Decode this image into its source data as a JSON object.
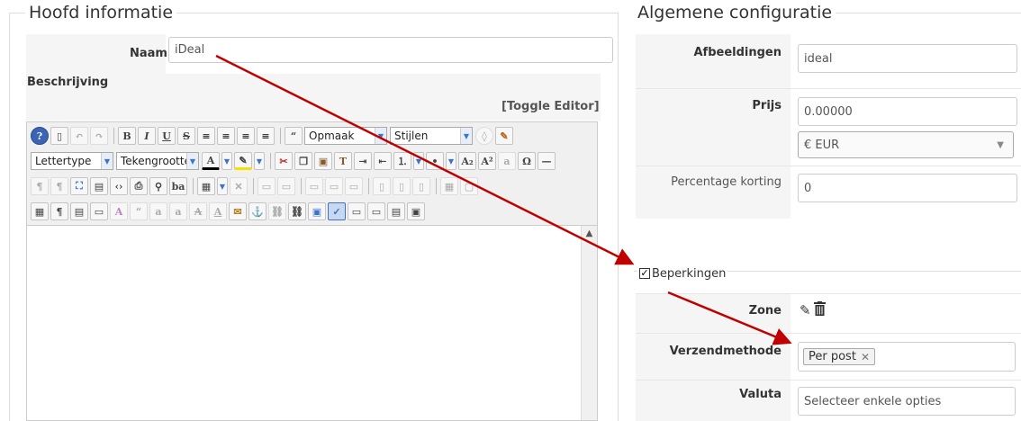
{
  "left_fieldset": {
    "legend": "Hoofd informatie",
    "name_label": "Naam",
    "name_value": "iDeal",
    "description_label": "Beschrijving",
    "toggle_editor": "[Toggle Editor]"
  },
  "editor": {
    "format_combo": "Opmaak",
    "styles_combo": "Stijlen",
    "font_combo": "Lettertype",
    "size_combo": "Tekengrootte"
  },
  "right_fieldset": {
    "legend": "Algemene configuratie",
    "images_label": "Afbeeldingen",
    "images_value": "ideal",
    "price_label": "Prijs",
    "price_value": "0.00000",
    "currency_value": "€ EUR",
    "discount_label": "Percentage korting",
    "discount_value": "0"
  },
  "restrictions": {
    "legend": "Beperkingen",
    "checked": true,
    "zone_label": "Zone",
    "shipping_label": "Verzendmethode",
    "shipping_tag": "Per post",
    "currency_label": "Valuta",
    "currency_placeholder": "Selecteer enkele opties"
  },
  "colors": {
    "arrow": "#c00000",
    "row_bg": "#f5f5f5",
    "border": "#cccccc"
  }
}
